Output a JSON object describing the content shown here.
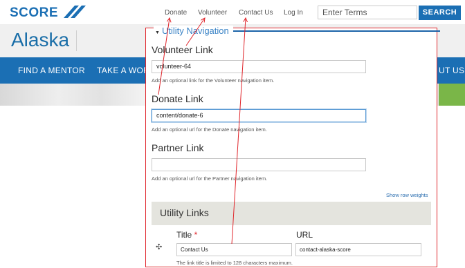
{
  "site": {
    "logo": "SCORE",
    "title": "Alaska",
    "utility_nav": [
      "Donate",
      "Volunteer",
      "Contact Us",
      "Log In"
    ],
    "search": {
      "placeholder": "Enter Terms",
      "button": "SEARCH"
    },
    "main_nav": [
      "FIND A MENTOR",
      "TAKE A WOR",
      "UT US"
    ],
    "colors": {
      "brand": "#1b6fb4",
      "accent_green": "#7ab648",
      "highlight": "#e0242a"
    }
  },
  "panel": {
    "legend": "Utility Navigation",
    "fields": [
      {
        "label": "Volunteer Link",
        "value": "volunteer-64",
        "help": "Add an optional link for the Volunteer navigation item."
      },
      {
        "label": "Donate Link",
        "value": "content/donate-6",
        "help": "Add an optional url for the Donate navigation item."
      },
      {
        "label": "Partner Link",
        "value": "",
        "help": "Add an optional url for the Partner navigation item."
      }
    ],
    "row_weights": "Show row weights",
    "links_section": "Utility Links",
    "columns": {
      "title": "Title",
      "required": "*",
      "url": "URL"
    },
    "row": {
      "title": "Contact Us",
      "url": "contact-alaska-score"
    },
    "limit_note": "The link title is limited to 128 characters maximum."
  }
}
